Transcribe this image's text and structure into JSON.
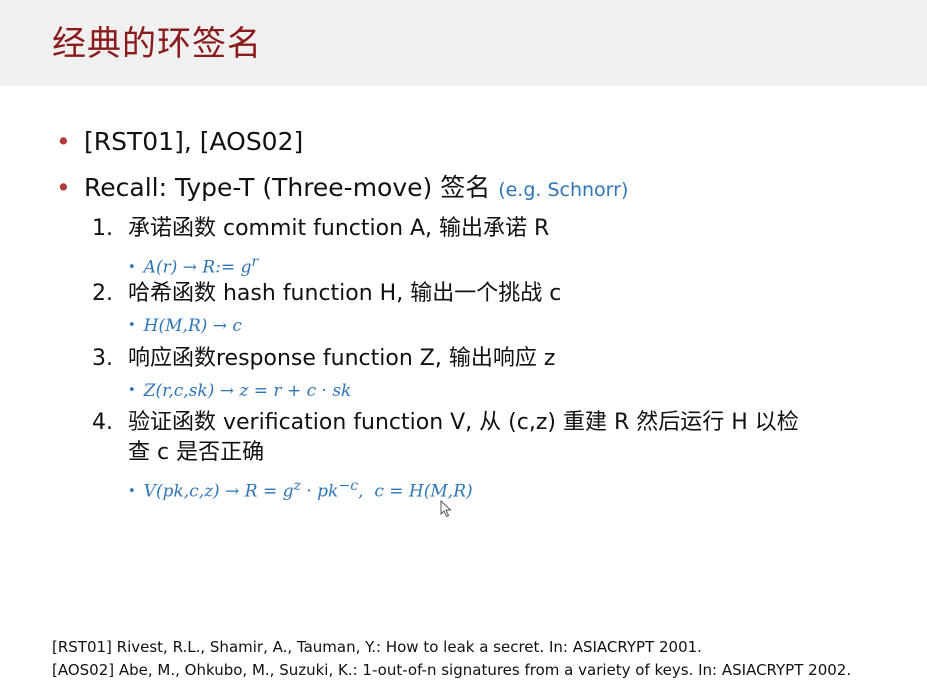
{
  "title": "经典的环签名",
  "bullets": [
    {
      "text": "[RST01], [AOS02]"
    },
    {
      "text": "Recall: Type-T (Three-move) 签名 ",
      "note": "(e.g. Schnorr)"
    }
  ],
  "steps": [
    {
      "num": "1.",
      "text": "承诺函数 commit function A, 输出承诺 R",
      "formula": "A(r) → R:= g^r"
    },
    {
      "num": "2.",
      "text": "哈希函数 hash function H, 输出一个挑战 c",
      "formula": "H(M,R) → c"
    },
    {
      "num": "3.",
      "text": "响应函数response function Z, 输出响应 z",
      "formula": "Z(r,c,sk) → z = r + c · sk"
    },
    {
      "num": "4.",
      "text_line1": "验证函数 verification function V, 从 (c,z) 重建 R 然后运行 H 以检",
      "text_line2": "查 c 是否正确",
      "formula": "V(pk,c,z) → R = g^z · pk^−c,  c = H(M,R)"
    }
  ],
  "references": [
    "[RST01] Rivest, R.L., Shamir, A., Tauman, Y.: How to leak a secret. In: ASIACRYPT 2001.",
    "[AOS02] Abe, M., Ohkubo, M., Suzuki, K.: 1-out-of-n signatures from a variety of keys. In: ASIACRYPT 2002."
  ],
  "colors": {
    "title": "#8b1a1a",
    "bullet": "#b03a3a",
    "accent": "#2e75b6"
  },
  "icons": {
    "cursor": "mouse-pointer-icon"
  }
}
